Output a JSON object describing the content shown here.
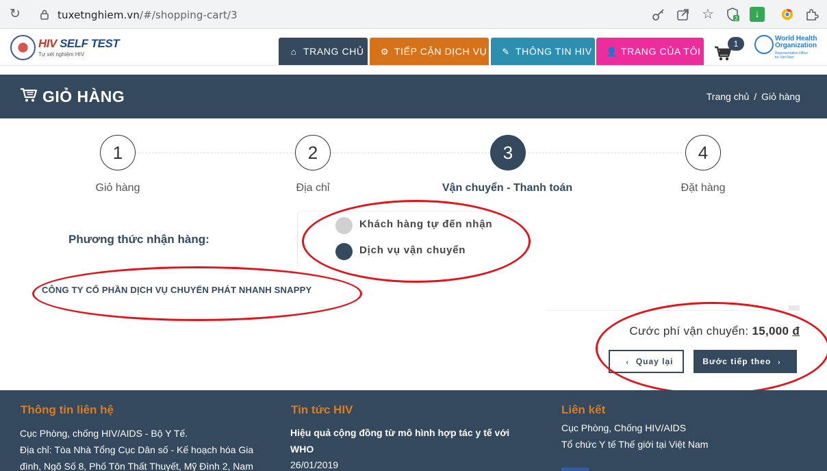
{
  "browser": {
    "url_host": "tuxetnghiem.vn",
    "url_path": "/#/shopping-cart/3",
    "ext_badge": "2"
  },
  "header": {
    "logo_red": "HIV",
    "logo_blue": " SELF TEST",
    "logo_sub": "Tự xét nghiệm HIV",
    "nav": {
      "home": "TRANG CHỦ",
      "services": "TIẾP CẬN DỊCH VỤ",
      "info": "THÔNG TIN HIV",
      "me": "TRANG CỦA TÔI"
    },
    "cart_count": "1",
    "who_line1": "World Health",
    "who_line2": "Organization",
    "who_sub1": "Representative Office",
    "who_sub2": "for Viet Nam"
  },
  "banner": {
    "title": "GIỎ HÀNG",
    "breadcrumb": [
      "Trang chủ",
      "/",
      "Giỏ hàng"
    ]
  },
  "steps": [
    {
      "number": "1",
      "label": "Giỏ hàng",
      "active": false
    },
    {
      "number": "2",
      "label": "Địa chỉ",
      "active": false
    },
    {
      "number": "3",
      "label": "Vận chuyển - Thanh toán",
      "active": true
    },
    {
      "number": "4",
      "label": "Đặt hàng",
      "active": false
    }
  ],
  "delivery": {
    "label": "Phương thức nhận hàng:",
    "options": [
      {
        "label": "Khách hàng tự đến nhận",
        "checked": false
      },
      {
        "label": "Dịch vụ vận chuyển",
        "checked": true
      }
    ],
    "carrier": "CÔNG TY CỔ PHẦN DỊCH VỤ CHUYỂN PHÁT NHANH SNAPPY"
  },
  "shipping": {
    "fee_label": "Cước phí vận chuyển:",
    "fee_value": "15,000",
    "currency": "đ"
  },
  "buttons": {
    "back_arrow": "‹",
    "back": "Quay lại",
    "next": "Bước tiếp theo",
    "next_arrow": "›"
  },
  "footer": {
    "contact_title": "Thông tin liên hệ",
    "contact_lines": [
      "Cục Phòng, chống HIV/AIDS - Bộ Y Tế.",
      "Địa chỉ: Tòa Nhà Tổng Cục Dân số - Kế hoạch hóa Gia",
      "đình, Ngõ Số 8, Phố Tôn Thất Thuyết, Mỹ Đình 2, Nam"
    ],
    "news_title": "Tin tức HIV",
    "news_lines": [
      "Hiệu quả cộng đồng từ mô hình hợp tác y tế với",
      "WHO"
    ],
    "news_date": "26/01/2019",
    "links_title": "Liên kết",
    "links": [
      "Cục Phòng, Chống HIV/AIDS",
      "Tổ chức Y tế Thế giới tại Việt Nam"
    ]
  },
  "colors": {
    "primary": "#34495e",
    "orange": "#d6731a",
    "teal": "#2c8fb0",
    "pink": "#ee2d9c",
    "annotation_red": "#e0141b",
    "footer_heading": "#e07b1a"
  },
  "icons": {
    "reload": "reload-icon",
    "lock": "lock-icon",
    "key": "key-icon",
    "share": "share-icon",
    "star": "star-icon",
    "home": "home-icon",
    "cogs": "cogs-icon",
    "wand": "magic-wand-icon",
    "user": "user-icon",
    "cart": "shopping-cart-icon"
  }
}
